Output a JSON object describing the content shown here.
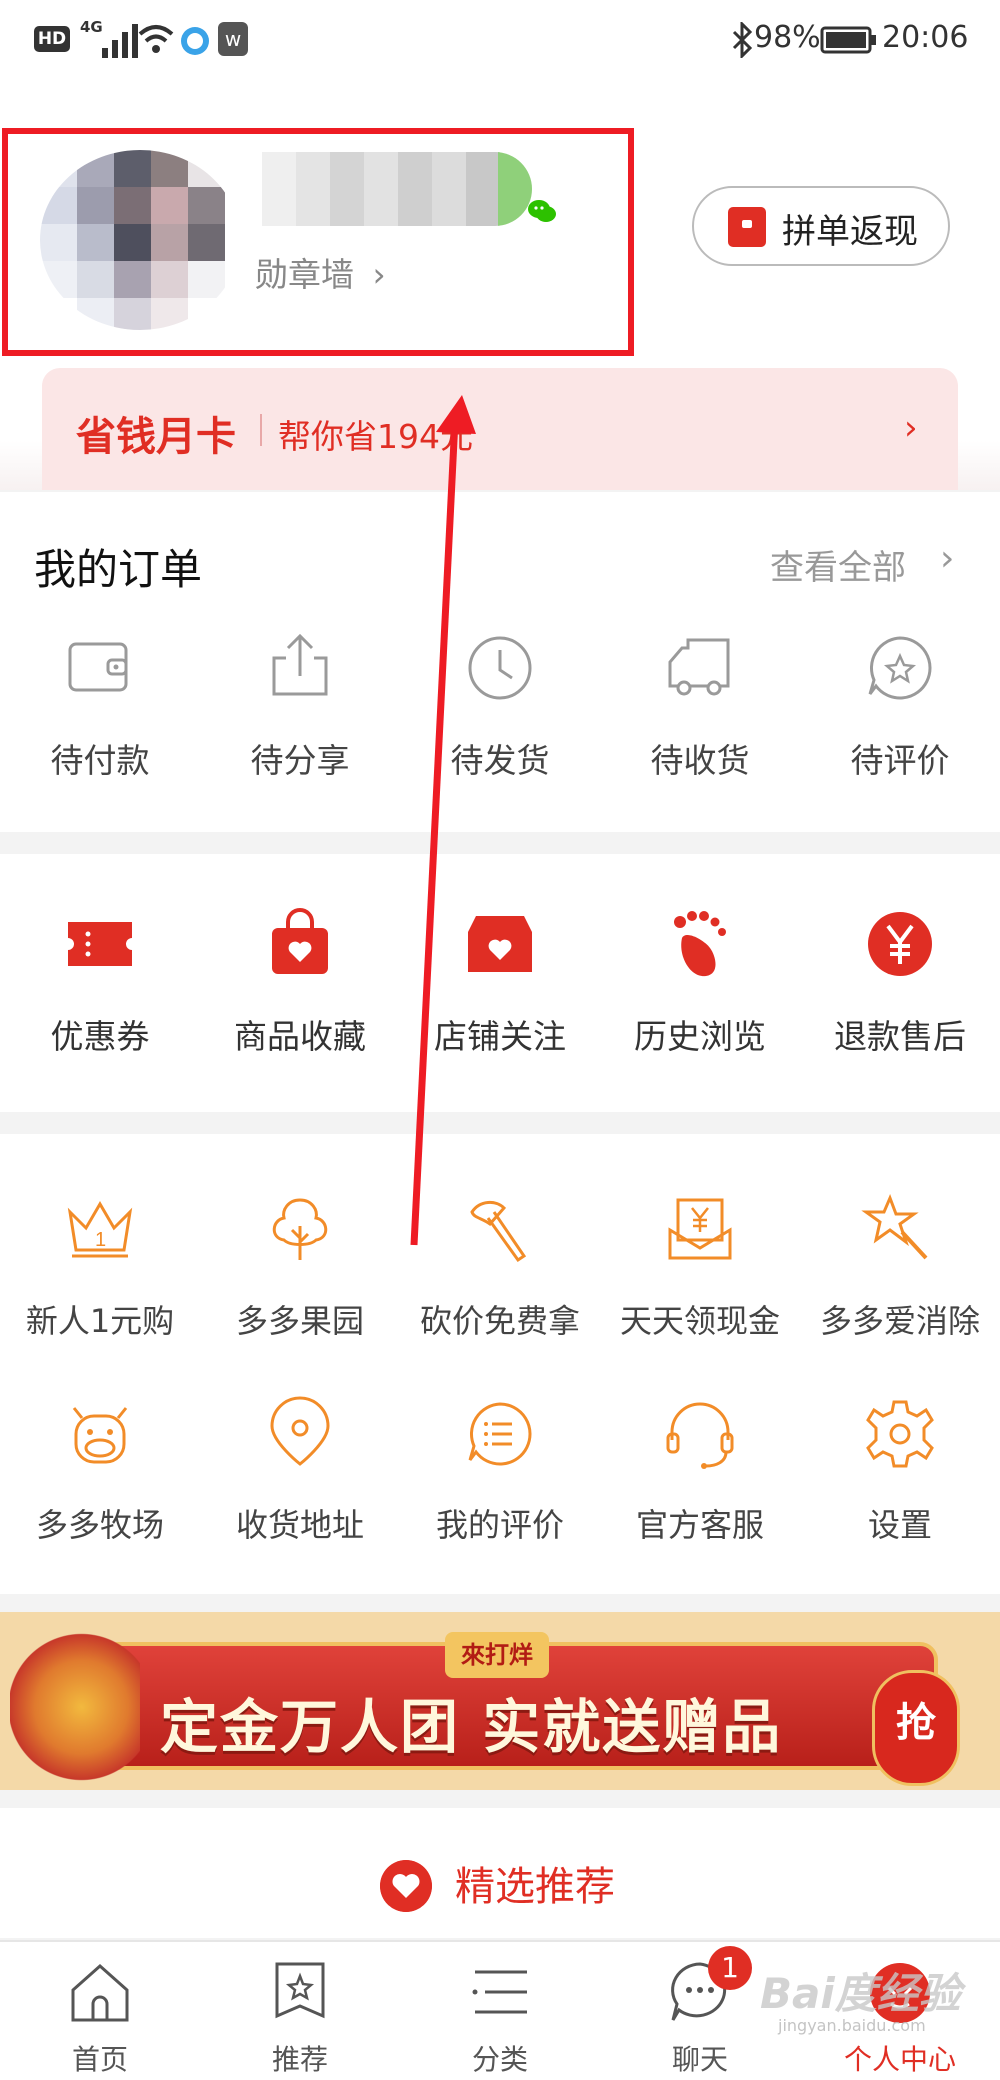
{
  "status_bar": {
    "left_icons": [
      "hd-icon",
      "4g-signal-icon",
      "wifi-icon",
      "qq-browser-icon",
      "app-notification-icon"
    ],
    "hd_label": "HD",
    "network_label": "4G",
    "bluetooth": "bluetooth-icon",
    "battery": "98%",
    "time": "20:06"
  },
  "profile": {
    "badge_wall_label": "勋章墙",
    "badge_wall_chevron": "›",
    "group_cashback_label": "拼单返现"
  },
  "month_card": {
    "title": "省钱月卡",
    "subtitle": "帮你省194元",
    "chevron": "›"
  },
  "orders": {
    "title": "我的订单",
    "view_all": "查看全部",
    "view_all_chevron": "›",
    "items": [
      {
        "label": "待付款",
        "icon": "wallet-icon"
      },
      {
        "label": "待分享",
        "icon": "share-icon"
      },
      {
        "label": "待发货",
        "icon": "clock-icon"
      },
      {
        "label": "待收货",
        "icon": "truck-icon"
      },
      {
        "label": "待评价",
        "icon": "review-star-icon"
      }
    ]
  },
  "shortcuts": {
    "items": [
      {
        "label": "优惠券",
        "icon": "coupon-icon"
      },
      {
        "label": "商品收藏",
        "icon": "favorites-bag-icon"
      },
      {
        "label": "店铺关注",
        "icon": "store-heart-icon"
      },
      {
        "label": "历史浏览",
        "icon": "footprint-icon"
      },
      {
        "label": "退款售后",
        "icon": "refund-yen-icon"
      }
    ]
  },
  "services": {
    "row1": [
      {
        "label": "新人1元购",
        "icon": "crown-icon"
      },
      {
        "label": "多多果园",
        "icon": "tree-icon"
      },
      {
        "label": "砍价免费拿",
        "icon": "axe-icon"
      },
      {
        "label": "天天领现金",
        "icon": "cash-envelope-icon"
      },
      {
        "label": "多多爱消除",
        "icon": "magic-wand-icon"
      }
    ],
    "row2": [
      {
        "label": "多多牧场",
        "icon": "cow-icon"
      },
      {
        "label": "收货地址",
        "icon": "location-pin-icon"
      },
      {
        "label": "我的评价",
        "icon": "comment-list-icon"
      },
      {
        "label": "官方客服",
        "icon": "headset-icon"
      },
      {
        "label": "设置",
        "icon": "settings-gear-icon"
      }
    ]
  },
  "banner": {
    "stamp": "來打烊",
    "text": "定金万人团  实就送赠品",
    "grab": "抢"
  },
  "recommend": {
    "label": "精选推荐"
  },
  "tabbar": {
    "items": [
      {
        "label": "首页",
        "icon": "home-icon"
      },
      {
        "label": "推荐",
        "icon": "recommend-star-icon"
      },
      {
        "label": "分类",
        "icon": "category-list-icon"
      },
      {
        "label": "聊天",
        "icon": "chat-bubble-icon"
      },
      {
        "label": "个人中心",
        "icon": "profile-center-icon"
      }
    ],
    "chat_unread": "1",
    "active": "个人中心"
  },
  "watermark": {
    "text": "Bai度经验",
    "url": "jingyan.baidu.com"
  },
  "colors": {
    "brand_red": "#e02e24",
    "service_orange": "#f28c28",
    "icon_gray": "#9a9a9a",
    "annotation_red": "#ee1c24"
  }
}
